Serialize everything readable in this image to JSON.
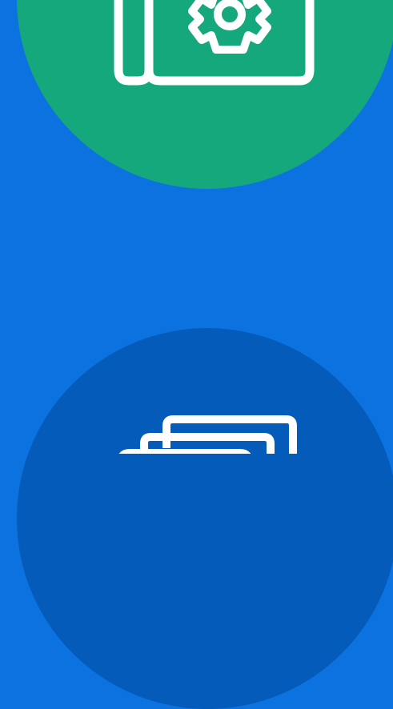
{
  "page": {
    "background_color": "#0b72e0"
  },
  "features": [
    {
      "icon": "blueprint-gear-icon",
      "circle_color": "#15a87c",
      "icon_color": "#ffffff"
    },
    {
      "icon": "stacked-documents-icon",
      "circle_color": "#045bba",
      "icon_color": "#ffffff"
    }
  ]
}
